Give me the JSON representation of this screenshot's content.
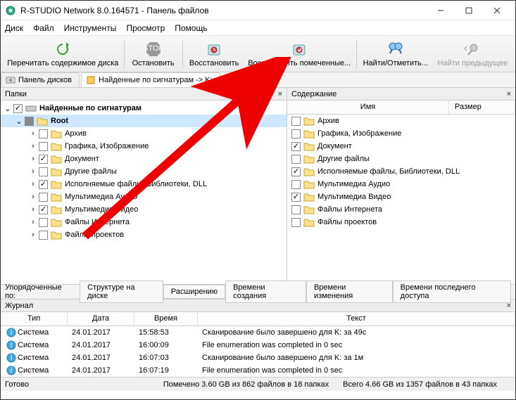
{
  "window": {
    "title": "R-STUDIO Network 8.0.164571 - Панель файлов"
  },
  "menu": [
    "Диск",
    "Файл",
    "Инструменты",
    "Просмотр",
    "Помощь"
  ],
  "toolbar": [
    {
      "label": "Перечитать содержимое диска",
      "icon": "refresh"
    },
    {
      "label": "Остановить",
      "icon": "stop"
    },
    {
      "label": "Восстановить",
      "icon": "recover"
    },
    {
      "label": "Восстановить помеченные...",
      "icon": "recover-marked"
    },
    {
      "label": "Найти/Отметить...",
      "icon": "find"
    },
    {
      "label": "Найти предыдущее",
      "icon": "find-prev"
    }
  ],
  "tabs": [
    {
      "label": "Панель дисков",
      "icon": "disk"
    },
    {
      "label": "Найденные по сигнатурам -> K:",
      "icon": "sig"
    }
  ],
  "leftPanel": {
    "title": "Папки"
  },
  "tree": {
    "root": {
      "label": "Найденные по сигнатурам"
    },
    "rootNode": {
      "label": "Root"
    },
    "items": [
      {
        "label": "Архив",
        "checked": false
      },
      {
        "label": "Графика, Изображение",
        "checked": false
      },
      {
        "label": "Документ",
        "checked": true
      },
      {
        "label": "Другие файлы",
        "checked": false
      },
      {
        "label": "Исполняемые файлы, Библиотеки, DLL",
        "checked": true
      },
      {
        "label": "Мультимедиа Аудио",
        "checked": false
      },
      {
        "label": "Мультимедиа Видео",
        "checked": true
      },
      {
        "label": "Файлы Интернета",
        "checked": false
      },
      {
        "label": "Файлы проектов",
        "checked": false
      }
    ]
  },
  "rightPanel": {
    "title": "Содержание",
    "cols": {
      "name": "Имя",
      "size": "Размер"
    }
  },
  "content": [
    {
      "label": "Архив",
      "checked": false
    },
    {
      "label": "Графика, Изображение",
      "checked": false
    },
    {
      "label": "Документ",
      "checked": true
    },
    {
      "label": "Другие файлы",
      "checked": false
    },
    {
      "label": "Исполняемые файлы, Библиотеки, DLL",
      "checked": true
    },
    {
      "label": "Мультимедиа Аудио",
      "checked": false
    },
    {
      "label": "Мультимедиа Видео",
      "checked": true
    },
    {
      "label": "Файлы Интернета",
      "checked": false
    },
    {
      "label": "Файлы проектов",
      "checked": false
    }
  ],
  "sort": {
    "label": "Упорядоченные по:",
    "opts": [
      "Структуре на диске",
      "Расширению",
      "Времени создания",
      "Времени изменения",
      "Времени последнего доступа"
    ]
  },
  "log": {
    "title": "Журнал",
    "cols": {
      "type": "Тип",
      "date": "Дата",
      "time": "Время",
      "text": "Текст"
    },
    "rows": [
      {
        "type": "Система",
        "date": "24.01.2017",
        "time": "15:58:53",
        "text": "Сканирование было завершено для K: за 49с"
      },
      {
        "type": "Система",
        "date": "24.01.2017",
        "time": "16:00:09",
        "text": "File enumeration was completed in 0 sec"
      },
      {
        "type": "Система",
        "date": "24.01.2017",
        "time": "16:07:03",
        "text": "Сканирование было завершено для K: за 1м"
      },
      {
        "type": "Система",
        "date": "24.01.2017",
        "time": "16:07:19",
        "text": "File enumeration was completed in 0 sec"
      }
    ]
  },
  "status": {
    "ready": "Готово",
    "marked": "Помечено 3.60 GB из 862 файлов в 18 папках",
    "total": "Всего 4.66 GB из 1357 файлов в 43 папках"
  }
}
